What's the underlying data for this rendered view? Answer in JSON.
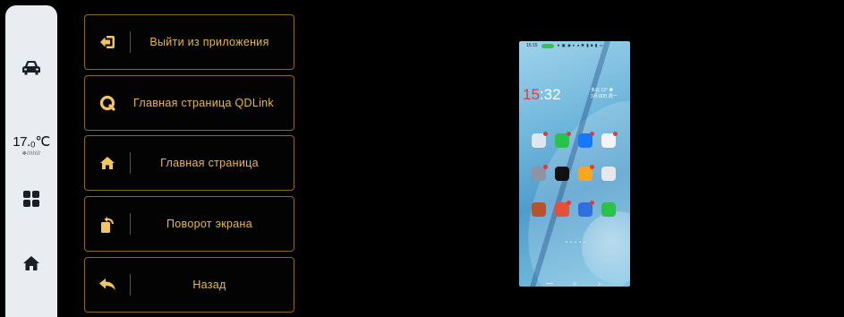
{
  "dock": {
    "temperature": "17.₀℃",
    "fan_level": "❄///////"
  },
  "menu": {
    "items": [
      {
        "label": "Выйти из приложения",
        "icon": "exit-icon"
      },
      {
        "label": "Главная страница QDLink",
        "icon": "qdlink-logo-icon"
      },
      {
        "label": "Главная страница",
        "icon": "home-icon"
      },
      {
        "label": "Поворот экрана",
        "icon": "rotate-screen-icon"
      },
      {
        "label": "Назад",
        "icon": "back-arrow-icon"
      }
    ]
  },
  "phone": {
    "status_time": "16:15",
    "clock_hours": "15",
    "clock_rest": ":32",
    "weather_line1": "多云 12° ☀",
    "weather_line2": "3月18日 周一"
  },
  "colors": {
    "accent": "#e7b755",
    "border": "#8a6a1e",
    "dock_bg": "#e9edf2"
  }
}
